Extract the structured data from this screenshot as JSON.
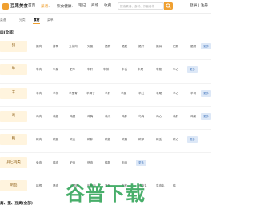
{
  "header": {
    "brand": "豆果美食",
    "nav": [
      {
        "label": "首页"
      },
      {
        "label": "菜谱",
        "active": true,
        "caret": "▾"
      },
      {
        "label": "饮食健康",
        "caret": "▾"
      },
      {
        "label": "笔记"
      },
      {
        "label": "商城"
      },
      {
        "label": "收藏"
      }
    ],
    "search_placeholder": "搜索菜谱、食材、作者名称",
    "login": "登录 | 注册",
    "accent": "#f0a030"
  },
  "subnav": [
    {
      "label": "菜谱"
    },
    {
      "label": "分类"
    },
    {
      "label": "食材",
      "active": true
    },
    {
      "label": "菜单"
    }
  ],
  "section_title": "肉(全部)",
  "rows": [
    {
      "category": "猪",
      "items": [
        "猪肉",
        "排骨",
        "五花肉",
        "火腿",
        "猪蹄",
        "猪肚",
        "猪肝",
        "猪耳",
        "肥肠",
        "腊肠"
      ],
      "more": "更多"
    },
    {
      "category": "牛",
      "items": [
        "牛肉",
        "牛腩",
        "肥牛",
        "牛肝",
        "牛排",
        "牛舌",
        "牛尾",
        "牛筋",
        "牛心"
      ],
      "more": "更多"
    },
    {
      "category": "羊",
      "items": [
        "羊肉",
        "羊排",
        "羊里脊",
        "羊蝎子",
        "羊肝",
        "羊腿",
        "羊肚",
        "羊尾",
        "羊心",
        "羊肾"
      ],
      "more": "更多"
    },
    {
      "category": "鸡",
      "items": [
        "鸡肉",
        "鸡翅",
        "鸡腿",
        "鸡胸",
        "鸡爪",
        "鸡胗",
        "乌鸡",
        "鸡心",
        "鸡肝",
        "鸡架"
      ],
      "more": "更多"
    },
    {
      "category": "鸭",
      "items": [
        "鸭肉",
        "鸭腿",
        "鸭血",
        "鸭胗",
        "鸭翅",
        "鸭肠",
        "鸭掌",
        "鸭舌",
        "鸭心"
      ],
      "more": "更多"
    },
    {
      "category": "其它肉类",
      "items": [
        "兔肉",
        "鹅肉",
        "驴肉",
        "鸽肉",
        "鹌鹑",
        "狗肉"
      ],
      "more": "更多"
    },
    {
      "category": "制品",
      "items": [
        "培根",
        "腊肉",
        "火腿肠",
        "午餐肉",
        "香肠",
        "肉松",
        "鸡肉丸",
        "牛肉丸",
        "鸭"
      ],
      "more": ""
    }
  ],
  "section_title_2": "禽、蛋、豆类(全部)",
  "watermark": "谷普下载"
}
